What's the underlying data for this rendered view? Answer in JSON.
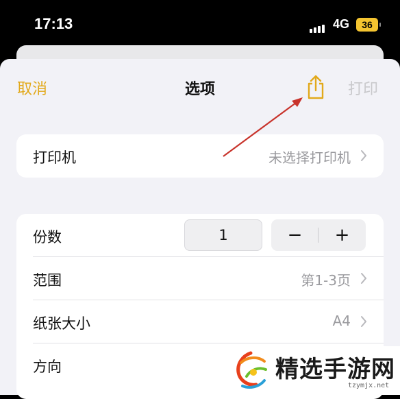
{
  "status_bar": {
    "time": "17:13",
    "network": "4G",
    "battery": "36",
    "signal_icon": "cellular-signal-icon",
    "battery_color": "#f4c430"
  },
  "nav": {
    "cancel_label": "取消",
    "title": "选项",
    "share_icon": "share-icon",
    "print_label": "打印",
    "accent_color": "#e2a91b"
  },
  "printer": {
    "label": "打印机",
    "value": "未选择打印机"
  },
  "options": {
    "copies_label": "份数",
    "copies_value": "1",
    "decrement_symbol": "−",
    "increment_symbol": "+",
    "range_label": "范围",
    "range_value": "第1-3页",
    "paper_label": "纸张大小",
    "paper_value": "A4",
    "orientation_label": "方向"
  },
  "watermark": {
    "text": "精选手游网",
    "url": "tzymjx.net"
  }
}
